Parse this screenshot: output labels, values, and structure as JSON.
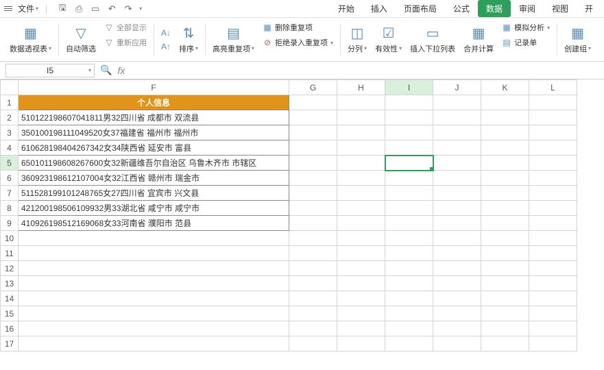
{
  "menubar": {
    "file": "文件",
    "tabs": [
      "开始",
      "插入",
      "页面布局",
      "公式",
      "数据",
      "审阅",
      "视图",
      "开"
    ],
    "active_tab": "数据"
  },
  "ribbon": {
    "pivot": "数据透视表",
    "autofilter": "自动筛选",
    "show_all": "全部显示",
    "reapply": "重新应用",
    "sort": "排序",
    "highlight_dup": "高亮重复项",
    "remove_dup": "删除重复项",
    "reject_dup": "拒绝录入重复项",
    "split": "分列",
    "validation": "有效性",
    "insert_dropdown": "插入下拉列表",
    "consolidate": "合并计算",
    "record": "记录单",
    "simulate": "模拟分析",
    "group": "创建组"
  },
  "namebox": "I5",
  "columns": [
    "F",
    "G",
    "H",
    "I",
    "J",
    "K",
    "L"
  ],
  "header_row": "个人信息",
  "rows": [
    "510122198607041811男32四川省  成都市  双流县",
    "350100198111049520女37福建省  福州市  福州市",
    "610628198404267342女34陕西省  延安市  富县",
    "650101198608267600女32新疆维吾尔自治区  乌鲁木齐市  市辖区",
    "360923198612107004女32江西省  赣州市  瑞金市",
    "511528199101248765女27四川省  宜宾市  兴文县",
    "421200198506109932男33湖北省  咸宁市  咸宁市",
    "410926198512169068女33河南省  濮阳市  范县"
  ],
  "active_cell": {
    "col": "I",
    "row": 5
  }
}
